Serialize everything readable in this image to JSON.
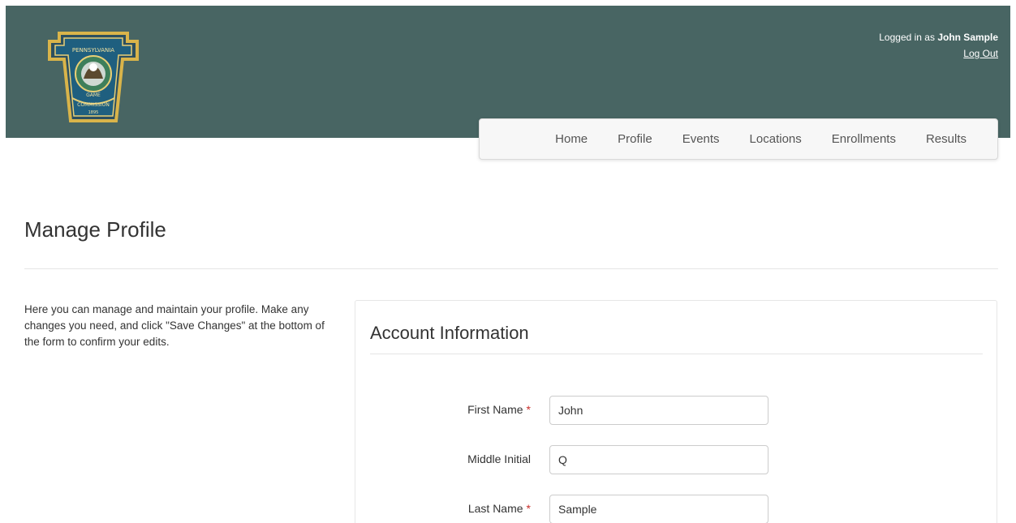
{
  "header": {
    "logged_in_prefix": "Logged in as ",
    "user_name": "John Sample",
    "logout_label": "Log Out",
    "background_color": "#486563",
    "logo_icon": "pennsylvania-game-commission-keystone-seal"
  },
  "nav": {
    "items": [
      {
        "label": "Home"
      },
      {
        "label": "Profile"
      },
      {
        "label": "Events"
      },
      {
        "label": "Locations"
      },
      {
        "label": "Enrollments"
      },
      {
        "label": "Results"
      }
    ]
  },
  "main": {
    "title": "Manage Profile",
    "intro": "Here you can manage and maintain your profile. Make any changes you need, and click \"Save Changes\" at the bottom of the form to confirm your edits."
  },
  "form": {
    "section_title": "Account Information",
    "required_marker": "*",
    "fields": [
      {
        "label": "First Name",
        "value": "John",
        "required": true
      },
      {
        "label": "Middle Initial",
        "value": "Q",
        "required": false
      },
      {
        "label": "Last Name",
        "value": "Sample",
        "required": true
      }
    ]
  }
}
